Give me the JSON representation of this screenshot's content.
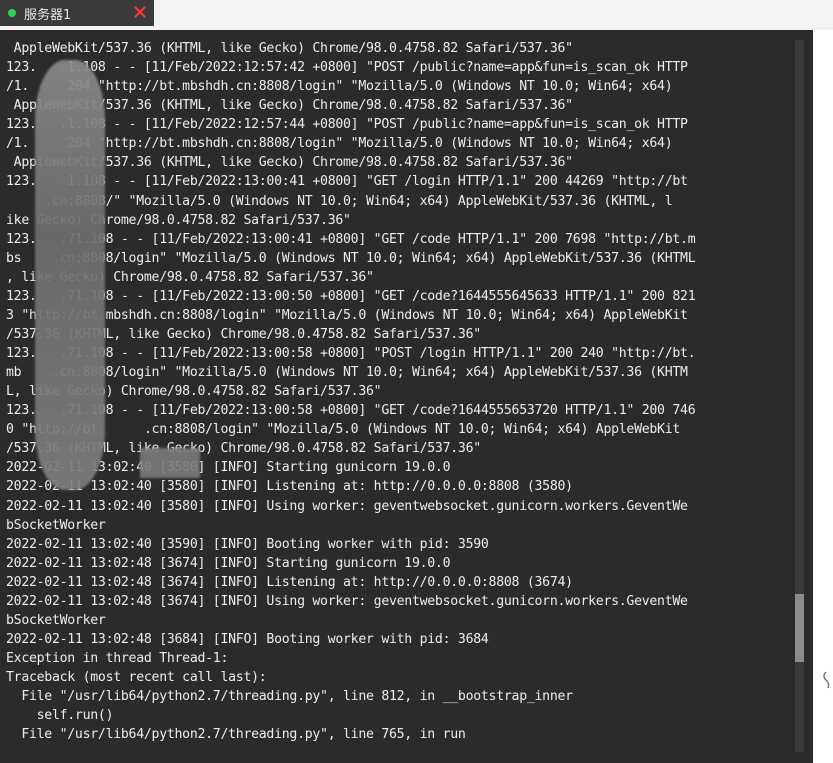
{
  "tab": {
    "title": "服务器1",
    "status_color": "#30d158",
    "close_icon": "close-icon",
    "close_color": "#ff3b30"
  },
  "terminal": {
    "bg": "#2b2b2b",
    "fg": "#ededed",
    "scroll_position": 0.86,
    "lines": [
      " AppleWebKit/537.36 (KHTML, like Gecko) Chrome/98.0.4758.82 Safari/537.36\"",
      "123.   .1.108 - - [11/Feb/2022:12:57:42 +0800] \"POST /public?name=app&fun=is_scan_ok HTTP",
      "/1.     204 \"http://bt.mbshdh.cn:8808/login\" \"Mozilla/5.0 (Windows NT 10.0; Win64; x64)",
      " AppleWebKit/537.36 (KHTML, like Gecko) Chrome/98.0.4758.82 Safari/537.36\"",
      "123.   .1.108 - - [11/Feb/2022:12:57:44 +0800] \"POST /public?name=app&fun=is_scan_ok HTTP",
      "/1.     204 \"http://bt.mbshdh.cn:8808/login\" \"Mozilla/5.0 (Windows NT 10.0; Win64; x64)",
      " AppleWebKit/537.36 (KHTML, like Gecko) Chrome/98.0.4758.82 Safari/537.36\"",
      "123.   .1.108 - - [11/Feb/2022:13:00:41 +0800] \"GET /login HTTP/1.1\" 200 44269 \"http://bt",
      "     .cn:8808/\" \"Mozilla/5.0 (Windows NT 10.0; Win64; x64) AppleWebKit/537.36 (KHTML, l",
      "ike Gecko) Chrome/98.0.4758.82 Safari/537.36\"",
      "123.   .71.108 - - [11/Feb/2022:13:00:41 +0800] \"GET /code HTTP/1.1\" 200 7698 \"http://bt.m",
      "bs    .cn:8808/login\" \"Mozilla/5.0 (Windows NT 10.0; Win64; x64) AppleWebKit/537.36 (KHTML",
      ", like Gecko) Chrome/98.0.4758.82 Safari/537.36\"",
      "123.   .71.108 - - [11/Feb/2022:13:00:50 +0800] \"GET /code?1644555645633 HTTP/1.1\" 200 821",
      "3 \"http://bt.mbshdh.cn:8808/login\" \"Mozilla/5.0 (Windows NT 10.0; Win64; x64) AppleWebKit",
      "/537.36 (KHTML, like Gecko) Chrome/98.0.4758.82 Safari/537.36\"",
      "123.   .71.108 - - [11/Feb/2022:13:00:58 +0800] \"POST /login HTTP/1.1\" 200 240 \"http://bt.",
      "mb    .cn:8808/login\" \"Mozilla/5.0 (Windows NT 10.0; Win64; x64) AppleWebKit/537.36 (KHTM",
      "L, like Gecko) Chrome/98.0.4758.82 Safari/537.36\"",
      "123.   .71.108 - - [11/Feb/2022:13:00:58 +0800] \"GET /code?1644555653720 HTTP/1.1\" 200 746",
      "0 \"http://bt.     .cn:8808/login\" \"Mozilla/5.0 (Windows NT 10.0; Win64; x64) AppleWebKit",
      "/537.36 (KHTML, like Gecko) Chrome/98.0.4758.82 Safari/537.36\"",
      "2022-02-11 13:02:40 [3580] [INFO] Starting gunicorn 19.0.0",
      "2022-02-11 13:02:40 [3580] [INFO] Listening at: http://0.0.0.0:8808 (3580)",
      "2022-02-11 13:02:40 [3580] [INFO] Using worker: geventwebsocket.gunicorn.workers.GeventWe",
      "bSocketWorker",
      "2022-02-11 13:02:40 [3590] [INFO] Booting worker with pid: 3590",
      "2022-02-11 13:02:48 [3674] [INFO] Starting gunicorn 19.0.0",
      "2022-02-11 13:02:48 [3674] [INFO] Listening at: http://0.0.0.0:8808 (3674)",
      "2022-02-11 13:02:48 [3674] [INFO] Using worker: geventwebsocket.gunicorn.workers.GeventWe",
      "bSocketWorker",
      "2022-02-11 13:02:48 [3684] [INFO] Booting worker with pid: 3684",
      "Exception in thread Thread-1:",
      "Traceback (most recent call last):",
      "  File \"/usr/lib64/python2.7/threading.py\", line 812, in __bootstrap_inner",
      "    self.run()",
      "  File \"/usr/lib64/python2.7/threading.py\", line 765, in run"
    ]
  }
}
